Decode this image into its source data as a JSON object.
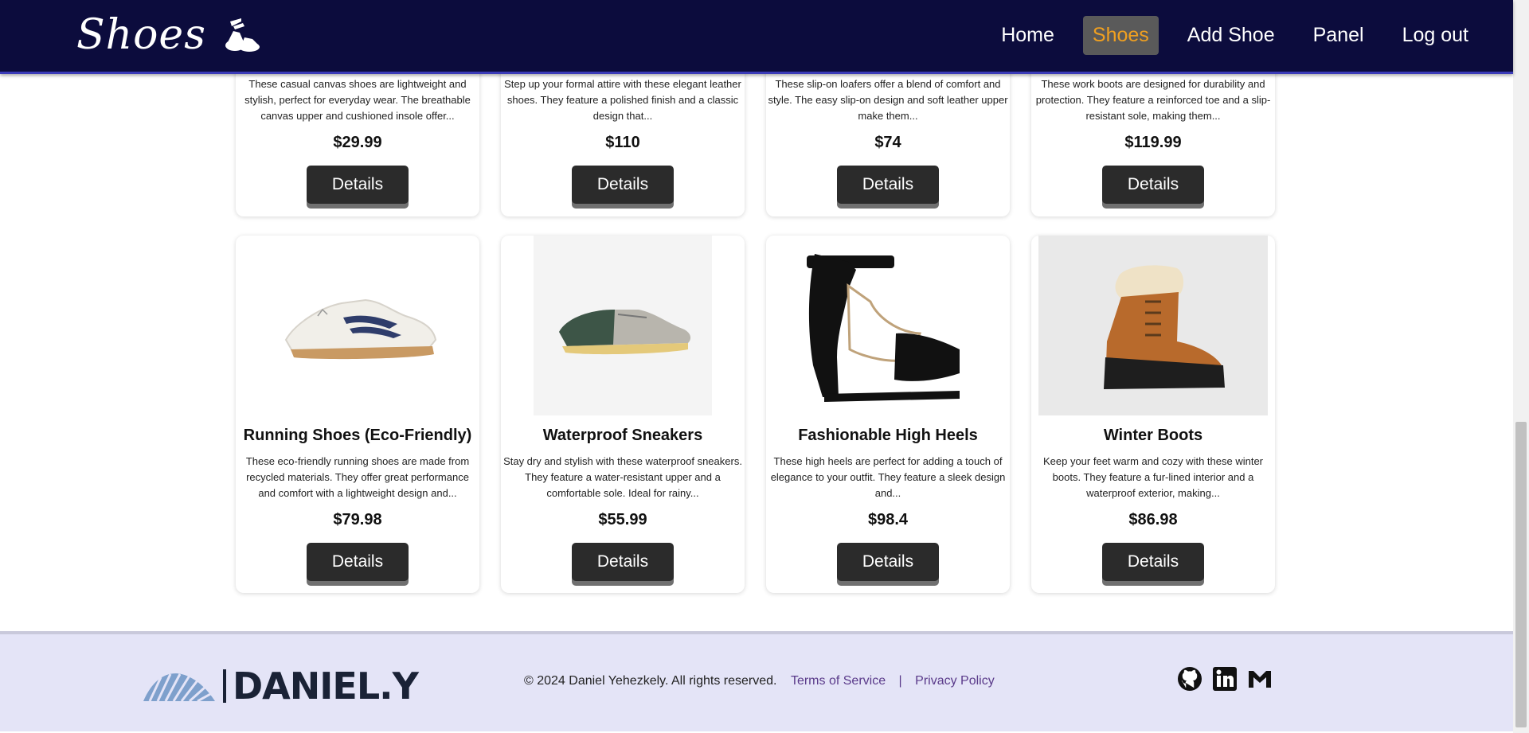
{
  "header": {
    "brand": "Shoes",
    "nav": [
      {
        "label": "Home",
        "active": false
      },
      {
        "label": "Shoes",
        "active": true
      },
      {
        "label": "Add Shoe",
        "active": false
      },
      {
        "label": "Panel",
        "active": false
      },
      {
        "label": "Log out",
        "active": false
      }
    ]
  },
  "products_top": [
    {
      "desc": "These casual canvas shoes are lightweight and stylish, perfect for everyday wear. The breathable canvas upper and cushioned insole offer...",
      "price": "$29.99",
      "button": "Details"
    },
    {
      "desc": "Step up your formal attire with these elegant leather shoes. They feature a polished finish and a classic design that...",
      "price": "$110",
      "button": "Details"
    },
    {
      "desc": "These slip-on loafers offer a blend of comfort and style. The easy slip-on design and soft leather upper make them...",
      "price": "$74",
      "button": "Details"
    },
    {
      "desc": "These work boots are designed for durability and protection. They feature a reinforced toe and a slip-resistant sole, making them...",
      "price": "$119.99",
      "button": "Details"
    }
  ],
  "products": [
    {
      "title": "Running Shoes (Eco-Friendly)",
      "desc": "These eco-friendly running shoes are made from recycled materials. They offer great performance and comfort with a lightweight design and...",
      "price": "$79.98",
      "button": "Details",
      "image": "running-shoe-image"
    },
    {
      "title": "Waterproof Sneakers",
      "desc": "Stay dry and stylish with these waterproof sneakers. They feature a water-resistant upper and a comfortable sole. Ideal for rainy...",
      "price": "$55.99",
      "button": "Details",
      "image": "sneaker-image"
    },
    {
      "title": "Fashionable High Heels",
      "desc": "These high heels are perfect for adding a touch of elegance to your outfit. They feature a sleek design and...",
      "price": "$98.4",
      "button": "Details",
      "image": "high-heel-image"
    },
    {
      "title": "Winter Boots",
      "desc": "Keep your feet warm and cozy with these winter boots. They feature a fur-lined interior and a waterproof exterior, making...",
      "price": "$86.98",
      "button": "Details",
      "image": "winter-boot-image"
    }
  ],
  "footer": {
    "logo": "DANIEL.Y",
    "copyright": "© 2024 Daniel Yehezkely. All rights reserved.",
    "terms": "Terms of Service",
    "separator": "|",
    "privacy": "Privacy Policy",
    "socials": [
      "github-icon",
      "linkedin-icon",
      "gmail-icon"
    ]
  },
  "colors": {
    "navbar": "#0c0c3d",
    "active_nav_text": "#f0a020",
    "button": "#2b2b2b",
    "footer": "#e4e4f7",
    "link": "#5a3a8a"
  }
}
